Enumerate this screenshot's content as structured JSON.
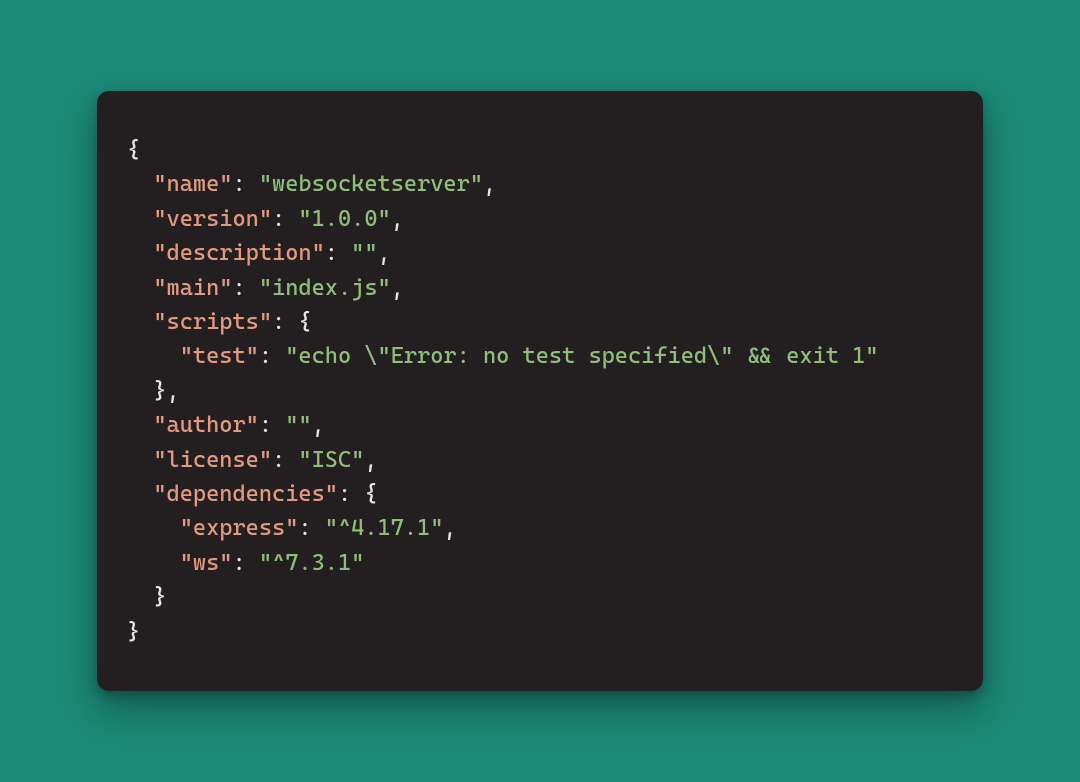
{
  "colors": {
    "bg": "#1c8a77",
    "card": "#231f20",
    "key": "#e49a80",
    "string": "#8fbf7a",
    "punct": "#e5e5e5"
  },
  "json": {
    "name": {
      "key": "\"name\"",
      "value": "\"websocketserver\""
    },
    "version": {
      "key": "\"version\"",
      "value": "\"1.0.0\""
    },
    "description": {
      "key": "\"description\"",
      "value": "\"\""
    },
    "main": {
      "key": "\"main\"",
      "value": "\"index.js\""
    },
    "scripts": {
      "key": "\"scripts\"",
      "test": {
        "key": "\"test\"",
        "value": "\"echo \\\"Error: no test specified\\\" && exit 1\""
      }
    },
    "author": {
      "key": "\"author\"",
      "value": "\"\""
    },
    "license": {
      "key": "\"license\"",
      "value": "\"ISC\""
    },
    "dependencies": {
      "key": "\"dependencies\"",
      "express": {
        "key": "\"express\"",
        "value": "\"^4.17.1\""
      },
      "ws": {
        "key": "\"ws\"",
        "value": "\"^7.3.1\""
      }
    }
  },
  "punct": {
    "obrace": "{",
    "cbrace": "}",
    "cbrace_comma": "},",
    "colon_sp": ": ",
    "comma": ",",
    "indent1": "  ",
    "indent2": "    "
  }
}
